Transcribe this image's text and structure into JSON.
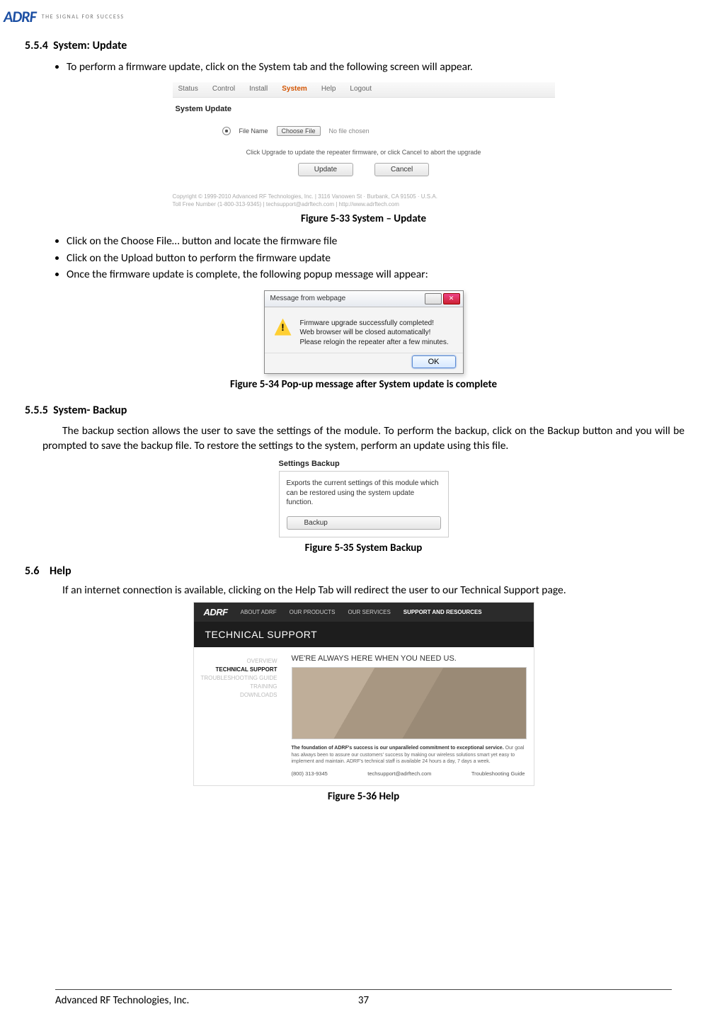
{
  "header": {
    "logo_text": "ADRF",
    "tagline": "THE SIGNAL FOR SUCCESS"
  },
  "sec_554": {
    "heading_num": "5.5.4",
    "heading_text": "System: Update",
    "bullet_intro": "To perform a firmware update, click on the System tab and the following screen will appear.",
    "fig33_caption": "Figure 5-33   System – Update",
    "bullet2": "Click on the Choose File… button and locate the firmware file",
    "bullet3": "Click on the Upload button to perform the firmware update",
    "bullet4": "Once the firmware update is complete, the following popup message will appear:",
    "fig34_caption": "Figure 5-34   Pop-up message after System update is complete"
  },
  "fig33": {
    "tabs": [
      "Status",
      "Control",
      "Install",
      "System",
      "Help",
      "Logout"
    ],
    "title": "System Update",
    "filename_label": "File Name",
    "choose_btn": "Choose File",
    "no_file": "No file chosen",
    "hint": "Click Upgrade to update the repeater firmware, or click Cancel to abort the upgrade",
    "btn_update": "Update",
    "btn_cancel": "Cancel",
    "footer1": "Copyright © 1999-2010 Advanced RF Technologies, Inc. | 3116 Vanowen St · Burbank, CA 91505 · U.S.A.",
    "footer2": "Toll Free Number (1-800-313-9345) | techsupport@adrftech.com | http://www.adrftech.com"
  },
  "fig34": {
    "title": "Message from webpage",
    "line1": "Firmware upgrade successfully completed!",
    "line2": "Web browser will be closed automatically!",
    "line3": "Please relogin the repeater after a few minutes.",
    "ok": "OK"
  },
  "sec_555": {
    "heading_num": "5.5.5",
    "heading_text": "System- Backup",
    "body": "The backup section allows the user to save the settings of the module. To perform the backup, click on the Backup button and you will be prompted to save the backup file.  To restore the settings to the system, perform an update using this file.",
    "fig35_caption": "Figure 5-35   System Backup"
  },
  "fig35": {
    "title": "Settings Backup",
    "desc": "Exports the current settings of this module which can be restored using the system update function.",
    "btn": "Backup"
  },
  "sec_56": {
    "heading_num": "5.6",
    "heading_text": "Help",
    "body": "If an internet connection is available, clicking on the Help Tab will redirect the user to our Technical Support page.",
    "fig36_caption": "Figure 5-36   Help"
  },
  "fig36": {
    "nav": [
      "ABOUT ADRF",
      "OUR PRODUCTS",
      "OUR SERVICES",
      "SUPPORT AND RESOURCES"
    ],
    "banner": "TECHNICAL SUPPORT",
    "side": [
      "OVERVIEW",
      "TECHNICAL SUPPORT",
      "TROUBLESHOOTING GUIDE",
      "TRAINING",
      "DOWNLOADS"
    ],
    "headline": "WE'RE ALWAYS HERE WHEN YOU NEED US.",
    "desc_bold": "The foundation of ADRF's success is our unparalleled commitment to exceptional service.",
    "desc_rest": " Our goal has always been to assure our customers' success by making our wireless solutions smart yet easy to implement and maintain. ADRF's technical staff is available 24 hours a day, 7 days a week.",
    "phone": "(800) 313-9345",
    "email": "techsupport@adrftech.com",
    "guide": "Troubleshooting Guide"
  },
  "footer": {
    "left": "Advanced RF Technologies, Inc.",
    "page": "37"
  }
}
